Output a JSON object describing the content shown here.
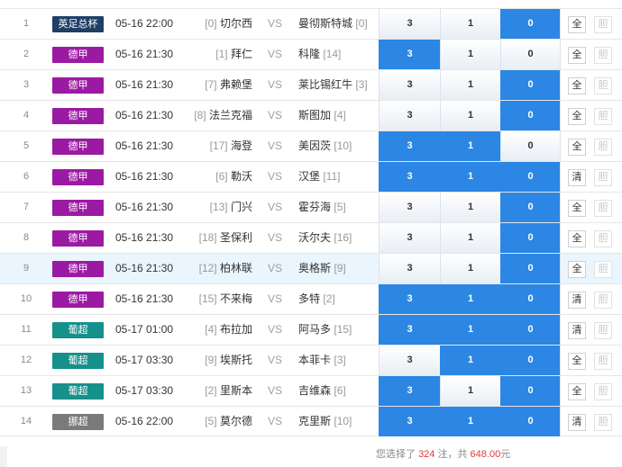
{
  "colors": {
    "league_epl": "#1e3f66",
    "league_bundesliga": "#9b1aa3",
    "league_primeira": "#15908a",
    "league_eliteserien": "#7a7a7a",
    "odds_selected": "#2b86e4"
  },
  "vs_label": "VS",
  "rows": [
    {
      "num": "1",
      "league": "英足总杯",
      "league_color": "#1e3f66",
      "time": "05-16 22:00",
      "home_rank": "[0]",
      "home": "切尔西",
      "away": "曼彻斯特城",
      "away_rank": "[0]",
      "odds": [
        {
          "label": "3",
          "selected": false
        },
        {
          "label": "1",
          "selected": false
        },
        {
          "label": "0",
          "selected": true
        }
      ],
      "btn1": "全",
      "btn2": "胆",
      "highlight": false
    },
    {
      "num": "2",
      "league": "德甲",
      "league_color": "#9b1aa3",
      "time": "05-16 21:30",
      "home_rank": "[1]",
      "home": "拜仁",
      "away": "科隆",
      "away_rank": "[14]",
      "odds": [
        {
          "label": "3",
          "selected": true
        },
        {
          "label": "1",
          "selected": false
        },
        {
          "label": "0",
          "selected": false
        }
      ],
      "btn1": "全",
      "btn2": "胆",
      "highlight": false
    },
    {
      "num": "3",
      "league": "德甲",
      "league_color": "#9b1aa3",
      "time": "05-16 21:30",
      "home_rank": "[7]",
      "home": "弗赖堡",
      "away": "莱比锡红牛",
      "away_rank": "[3]",
      "odds": [
        {
          "label": "3",
          "selected": false
        },
        {
          "label": "1",
          "selected": false
        },
        {
          "label": "0",
          "selected": true
        }
      ],
      "btn1": "全",
      "btn2": "胆",
      "highlight": false
    },
    {
      "num": "4",
      "league": "德甲",
      "league_color": "#9b1aa3",
      "time": "05-16 21:30",
      "home_rank": "[8]",
      "home": "法兰克福",
      "away": "斯图加",
      "away_rank": "[4]",
      "odds": [
        {
          "label": "3",
          "selected": false
        },
        {
          "label": "1",
          "selected": false
        },
        {
          "label": "0",
          "selected": true
        }
      ],
      "btn1": "全",
      "btn2": "胆",
      "highlight": false
    },
    {
      "num": "5",
      "league": "德甲",
      "league_color": "#9b1aa3",
      "time": "05-16 21:30",
      "home_rank": "[17]",
      "home": "海登",
      "away": "美因茨",
      "away_rank": "[10]",
      "odds": [
        {
          "label": "3",
          "selected": true
        },
        {
          "label": "1",
          "selected": true
        },
        {
          "label": "0",
          "selected": false
        }
      ],
      "btn1": "全",
      "btn2": "胆",
      "highlight": false
    },
    {
      "num": "6",
      "league": "德甲",
      "league_color": "#9b1aa3",
      "time": "05-16 21:30",
      "home_rank": "[6]",
      "home": "勒沃",
      "away": "汉堡",
      "away_rank": "[11]",
      "odds": [
        {
          "label": "3",
          "selected": true
        },
        {
          "label": "1",
          "selected": true
        },
        {
          "label": "0",
          "selected": true
        }
      ],
      "btn1": "清",
      "btn2": "胆",
      "highlight": false
    },
    {
      "num": "7",
      "league": "德甲",
      "league_color": "#9b1aa3",
      "time": "05-16 21:30",
      "home_rank": "[13]",
      "home": "门兴",
      "away": "霍芬海",
      "away_rank": "[5]",
      "odds": [
        {
          "label": "3",
          "selected": false
        },
        {
          "label": "1",
          "selected": false
        },
        {
          "label": "0",
          "selected": true
        }
      ],
      "btn1": "全",
      "btn2": "胆",
      "highlight": false
    },
    {
      "num": "8",
      "league": "德甲",
      "league_color": "#9b1aa3",
      "time": "05-16 21:30",
      "home_rank": "[18]",
      "home": "圣保利",
      "away": "沃尔夫",
      "away_rank": "[16]",
      "odds": [
        {
          "label": "3",
          "selected": false
        },
        {
          "label": "1",
          "selected": false
        },
        {
          "label": "0",
          "selected": true
        }
      ],
      "btn1": "全",
      "btn2": "胆",
      "highlight": false
    },
    {
      "num": "9",
      "league": "德甲",
      "league_color": "#9b1aa3",
      "time": "05-16 21:30",
      "home_rank": "[12]",
      "home": "柏林联",
      "away": "奥格斯",
      "away_rank": "[9]",
      "odds": [
        {
          "label": "3",
          "selected": false
        },
        {
          "label": "1",
          "selected": false
        },
        {
          "label": "0",
          "selected": true
        }
      ],
      "btn1": "全",
      "btn2": "胆",
      "highlight": true
    },
    {
      "num": "10",
      "league": "德甲",
      "league_color": "#9b1aa3",
      "time": "05-16 21:30",
      "home_rank": "[15]",
      "home": "不来梅",
      "away": "多特",
      "away_rank": "[2]",
      "odds": [
        {
          "label": "3",
          "selected": true
        },
        {
          "label": "1",
          "selected": true
        },
        {
          "label": "0",
          "selected": true
        }
      ],
      "btn1": "清",
      "btn2": "胆",
      "highlight": false
    },
    {
      "num": "11",
      "league": "葡超",
      "league_color": "#15908a",
      "time": "05-17 01:00",
      "home_rank": "[4]",
      "home": "布拉加",
      "away": "阿马多",
      "away_rank": "[15]",
      "odds": [
        {
          "label": "3",
          "selected": true
        },
        {
          "label": "1",
          "selected": true
        },
        {
          "label": "0",
          "selected": true
        }
      ],
      "btn1": "清",
      "btn2": "胆",
      "highlight": false
    },
    {
      "num": "12",
      "league": "葡超",
      "league_color": "#15908a",
      "time": "05-17 03:30",
      "home_rank": "[9]",
      "home": "埃斯托",
      "away": "本菲卡",
      "away_rank": "[3]",
      "odds": [
        {
          "label": "3",
          "selected": false
        },
        {
          "label": "1",
          "selected": true
        },
        {
          "label": "0",
          "selected": true
        }
      ],
      "btn1": "全",
      "btn2": "胆",
      "highlight": false
    },
    {
      "num": "13",
      "league": "葡超",
      "league_color": "#15908a",
      "time": "05-17 03:30",
      "home_rank": "[2]",
      "home": "里斯本",
      "away": "吉维森",
      "away_rank": "[6]",
      "odds": [
        {
          "label": "3",
          "selected": true
        },
        {
          "label": "1",
          "selected": false
        },
        {
          "label": "0",
          "selected": true
        }
      ],
      "btn1": "全",
      "btn2": "胆",
      "highlight": false
    },
    {
      "num": "14",
      "league": "挪超",
      "league_color": "#7a7a7a",
      "time": "05-16 22:00",
      "home_rank": "[5]",
      "home": "莫尔德",
      "away": "克里斯",
      "away_rank": "[10]",
      "odds": [
        {
          "label": "3",
          "selected": true
        },
        {
          "label": "1",
          "selected": true
        },
        {
          "label": "0",
          "selected": true
        }
      ],
      "btn1": "清",
      "btn2": "胆",
      "highlight": false
    }
  ],
  "footer": {
    "prefix": "您选择了",
    "count": "324",
    "mid": "注，共",
    "amount": "648.00",
    "suffix": "元"
  }
}
